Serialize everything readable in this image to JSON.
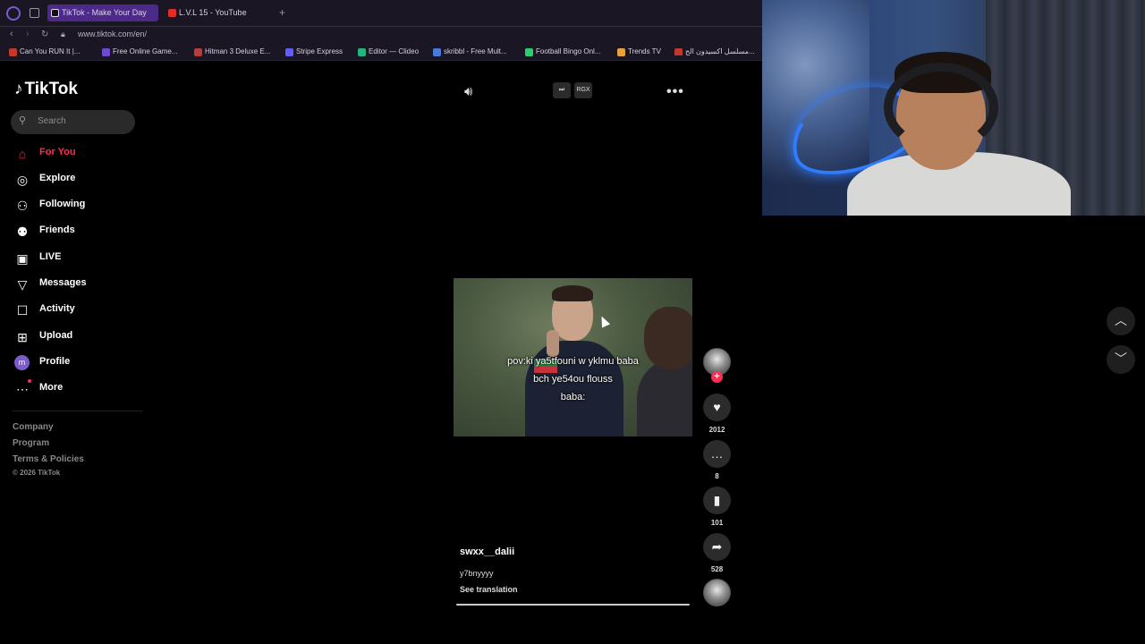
{
  "browser": {
    "tabs": [
      {
        "title": "TikTok - Make Your Day",
        "active": true
      },
      {
        "title": "L.V.L 15 - YouTube",
        "active": false
      }
    ],
    "url": "www.tiktok.com/en/",
    "bookmarks": [
      {
        "label": "Can You RUN It |...",
        "color": "#c0392b"
      },
      {
        "label": "Free Online Game...",
        "color": "#6c4bd1"
      },
      {
        "label": "Hitman 3 Deluxe E...",
        "color": "#b83b3b"
      },
      {
        "label": "Stripe Express",
        "color": "#635bff"
      },
      {
        "label": "Editor — Clideo",
        "color": "#24b47e"
      },
      {
        "label": "skribbl - Free Mult...",
        "color": "#4a7ad9"
      },
      {
        "label": "Football Bingo Onl...",
        "color": "#2ecc71"
      },
      {
        "label": "Trends TV",
        "color": "#e6a23c"
      },
      {
        "label": "مسلسل اكسيدون الح...",
        "color": "#c0392b"
      }
    ]
  },
  "sidebar": {
    "brand": "TikTok",
    "search_placeholder": "Search",
    "items": [
      {
        "label": "For You",
        "icon": "home-icon",
        "active": true
      },
      {
        "label": "Explore",
        "icon": "compass-icon"
      },
      {
        "label": "Following",
        "icon": "following-icon"
      },
      {
        "label": "Friends",
        "icon": "friends-icon"
      },
      {
        "label": "LIVE",
        "icon": "live-icon"
      },
      {
        "label": "Messages",
        "icon": "messages-icon"
      },
      {
        "label": "Activity",
        "icon": "activity-icon"
      },
      {
        "label": "Upload",
        "icon": "upload-icon"
      },
      {
        "label": "Profile",
        "icon": "profile-avatar",
        "avatar_letter": "m"
      },
      {
        "label": "More",
        "icon": "more-icon"
      }
    ],
    "footer": {
      "links": [
        "Company",
        "Program",
        "Terms & Policies"
      ],
      "copyright": "© 2026 TikTok"
    }
  },
  "player": {
    "controls": {
      "skip_label": "⏭",
      "quality_label": "RGX"
    },
    "caption_lines": [
      "pov:ki ya5tfouni w yklmu baba",
      "bch ye54ou flouss",
      "baba:"
    ],
    "author": "swxx__dalii",
    "description": "y7bnyyyy",
    "see_translation": "See translation",
    "progress": 1.0
  },
  "actions": {
    "likes": "2012",
    "comments": "8",
    "saves": "101",
    "shares": "528"
  },
  "colors": {
    "accent": "#fe2c55",
    "browser_chrome": "#1a1624",
    "active_tab": "#4d2a8a"
  }
}
